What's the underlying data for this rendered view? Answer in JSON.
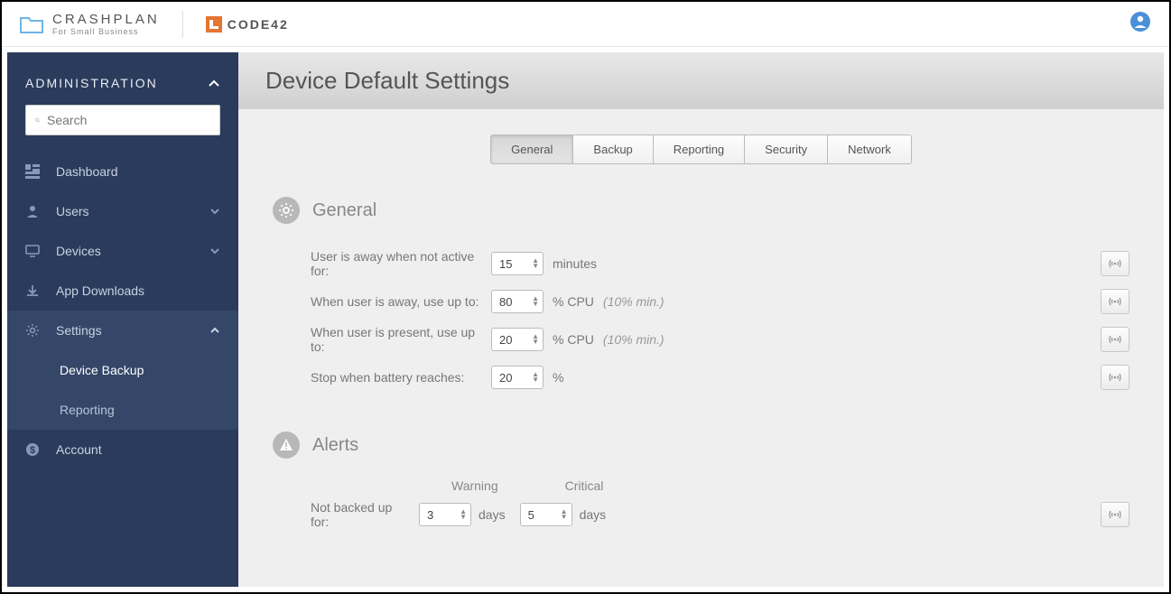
{
  "header": {
    "crashplan_main": "CRASHPLAN",
    "crashplan_sub": "For Small Business",
    "code42": "CODE42"
  },
  "sidebar": {
    "title": "ADMINISTRATION",
    "search_placeholder": "Search",
    "items": [
      {
        "id": "dashboard",
        "label": "Dashboard",
        "expandable": false
      },
      {
        "id": "users",
        "label": "Users",
        "expandable": true
      },
      {
        "id": "devices",
        "label": "Devices",
        "expandable": true
      },
      {
        "id": "downloads",
        "label": "App Downloads",
        "expandable": false
      },
      {
        "id": "settings",
        "label": "Settings",
        "expandable": true,
        "expanded": true
      },
      {
        "id": "account",
        "label": "Account",
        "expandable": false
      }
    ],
    "settings_sub": [
      {
        "id": "device-backup",
        "label": "Device Backup",
        "active": true
      },
      {
        "id": "reporting",
        "label": "Reporting",
        "active": false
      }
    ]
  },
  "page": {
    "title": "Device Default Settings",
    "tabs": [
      {
        "id": "general",
        "label": "General",
        "active": true
      },
      {
        "id": "backup",
        "label": "Backup"
      },
      {
        "id": "reporting",
        "label": "Reporting"
      },
      {
        "id": "security",
        "label": "Security"
      },
      {
        "id": "network",
        "label": "Network"
      }
    ]
  },
  "general": {
    "title": "General",
    "away_label": "User is away when not active for:",
    "away_value": "15",
    "away_suffix": "minutes",
    "cpu_away_label": "When user is away, use up to:",
    "cpu_away_value": "80",
    "cpu_away_suffix": "% CPU",
    "cpu_away_hint": "(10% min.)",
    "cpu_present_label": "When user is present, use up to:",
    "cpu_present_value": "20",
    "cpu_present_suffix": "% CPU",
    "cpu_present_hint": "(10% min.)",
    "battery_label": "Stop when battery reaches:",
    "battery_value": "20",
    "battery_suffix": "%"
  },
  "alerts": {
    "title": "Alerts",
    "col_warning": "Warning",
    "col_critical": "Critical",
    "not_backed_label": "Not backed up for:",
    "warning_value": "3",
    "warning_suffix": "days",
    "critical_value": "5",
    "critical_suffix": "days"
  }
}
